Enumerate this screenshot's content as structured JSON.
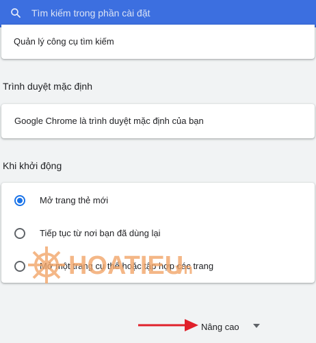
{
  "search": {
    "placeholder": "Tìm kiếm trong phần cài đặt"
  },
  "search_engine": {
    "manage_label": "Quản lý công cụ tìm kiếm"
  },
  "default_browser": {
    "title": "Trình duyệt mặc định",
    "status": "Google Chrome là trình duyệt mặc định của bạn"
  },
  "startup": {
    "title": "Khi khởi động",
    "options": [
      {
        "label": "Mở trang thẻ mới",
        "checked": true
      },
      {
        "label": "Tiếp tục từ nơi bạn đã dùng lại",
        "checked": false
      },
      {
        "label": "Mở một trang cụ thể hoặc tập hợp các trang",
        "checked": false
      }
    ]
  },
  "advanced": {
    "label": "Nâng cao"
  },
  "watermark": {
    "text": "HOATIEU",
    "suffix": ".vn"
  },
  "colors": {
    "header": "#3367d6",
    "accent": "#1a73e8",
    "arrow": "#e0202a",
    "watermark": "#f2a66a"
  },
  "icons": {
    "search": "search-icon",
    "chevron": "chevron-down-icon",
    "annotation": "arrow-right-icon"
  }
}
